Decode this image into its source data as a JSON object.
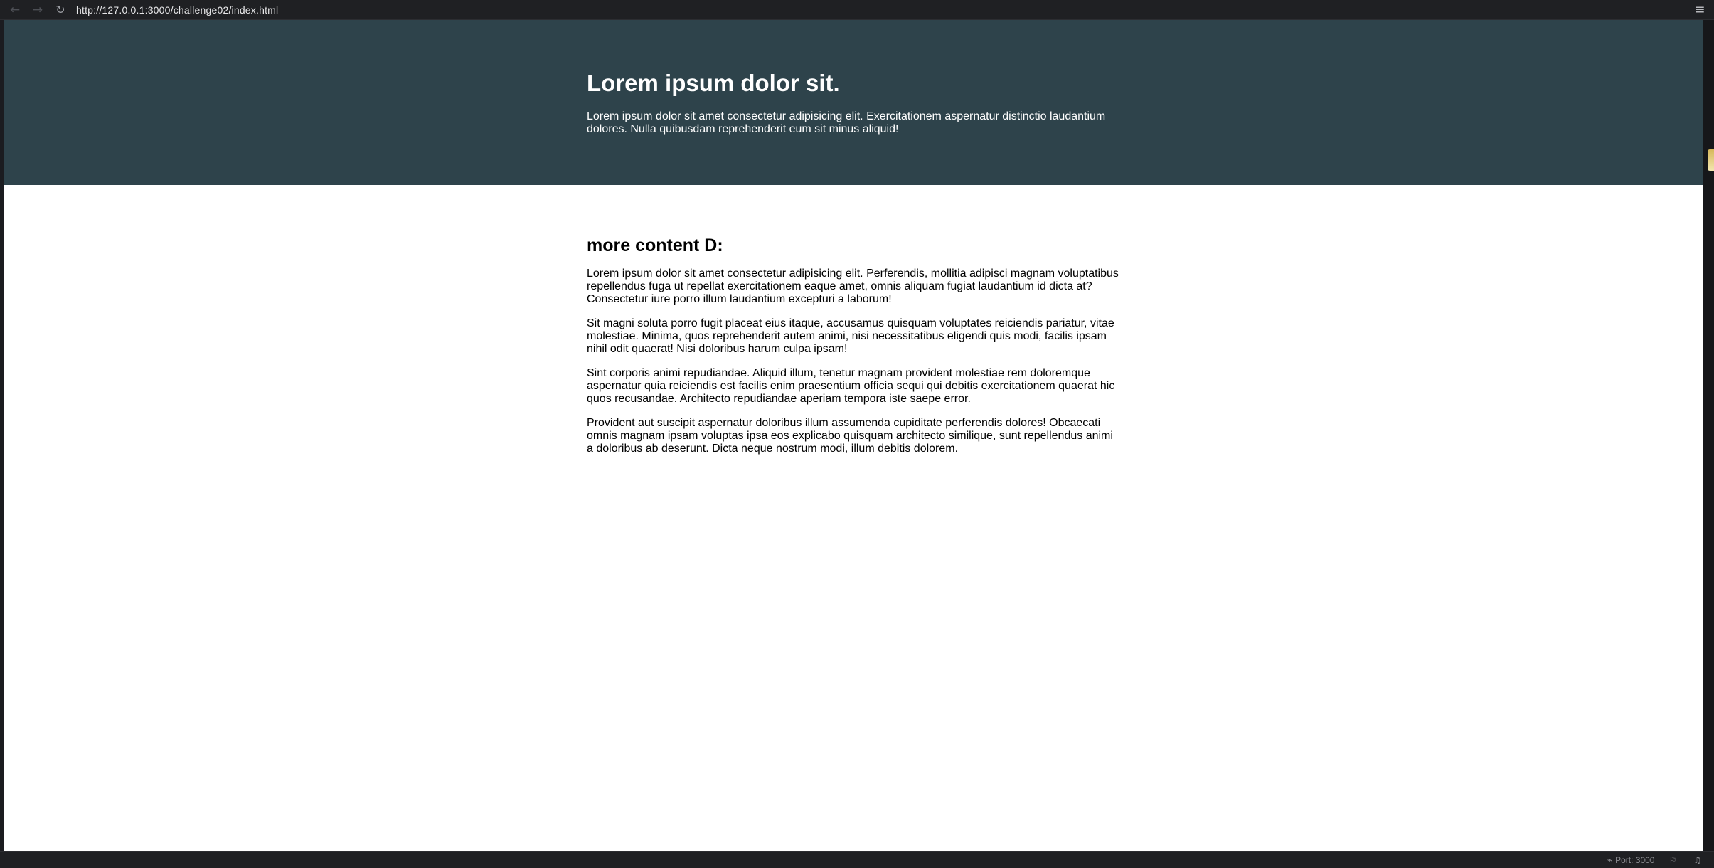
{
  "browser": {
    "url": "http://127.0.0.1:3000/challenge02/index.html",
    "back_icon": "arrow-left-icon",
    "forward_icon": "arrow-right-icon",
    "reload_icon": "reload-icon",
    "menu_icon": "hamburger-menu-icon"
  },
  "hero": {
    "title": "Lorem ipsum dolor sit.",
    "text": "Lorem ipsum dolor sit amet consectetur adipisicing elit. Exercitationem aspernatur distinctio laudantium dolores. Nulla quibusdam reprehenderit eum sit minus aliquid!"
  },
  "content": {
    "heading": "more content D:",
    "paragraphs": [
      "Lorem ipsum dolor sit amet consectetur adipisicing elit. Perferendis, mollitia adipisci magnam voluptatibus repellendus fuga ut repellat exercitationem eaque amet, omnis aliquam fugiat laudantium id dicta at? Consectetur iure porro illum laudantium excepturi a laborum!",
      "Sit magni soluta porro fugit placeat eius itaque, accusamus quisquam voluptates reiciendis pariatur, vitae molestiae. Minima, quos reprehenderit autem animi, nisi necessitatibus eligendi quis modi, facilis ipsam nihil odit quaerat! Nisi doloribus harum culpa ipsam!",
      "Sint corporis animi repudiandae. Aliquid illum, tenetur magnam provident molestiae rem doloremque aspernatur quia reiciendis est facilis enim praesentium officia sequi qui debitis exercitationem quaerat hic quos recusandae. Architecto repudiandae aperiam tempora iste saepe error.",
      "Provident aut suscipit aspernatur doloribus illum assumenda cupiditate perferendis dolores! Obcaecati omnis magnam ipsam voluptas ipsa eos explicabo quisquam architecto similique, sunt repellendus animi a doloribus ab deserunt. Dicta neque nostrum modi, illum debitis dolorem."
    ]
  },
  "status_bar": {
    "port_label": "Port: 3000"
  },
  "colors": {
    "hero_background": "#2e434b",
    "page_background": "#ffffff",
    "chrome_background": "#1f2023"
  }
}
